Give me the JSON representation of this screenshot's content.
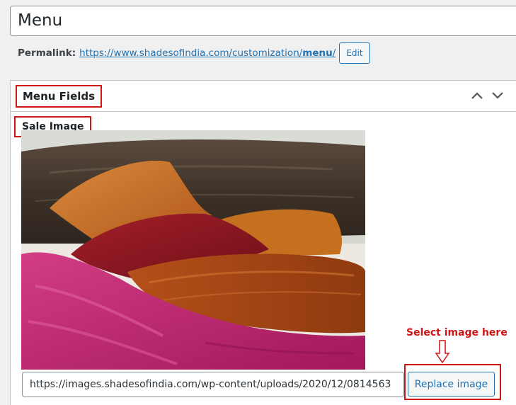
{
  "post": {
    "title": "Menu",
    "permalink_label": "Permalink:",
    "permalink_base": "https://www.shadesofindia.com/customization/",
    "permalink_slug": "menu",
    "permalink_trailing": "/",
    "edit_label": "Edit"
  },
  "metabox": {
    "title": "Menu Fields",
    "collapse_icon": "chevron-up-icon",
    "expand_icon": "chevron-down-icon",
    "field_label": "Sale Image",
    "image_url": "https://images.shadesofindia.com/wp-content/uploads/2020/12/0814563",
    "replace_label": "Replace image"
  },
  "annotation": {
    "text": "Select image here",
    "color": "#d11414"
  },
  "colors": {
    "accent": "#2271b1",
    "highlight": "#d11414",
    "background": "#f0f0f1"
  }
}
